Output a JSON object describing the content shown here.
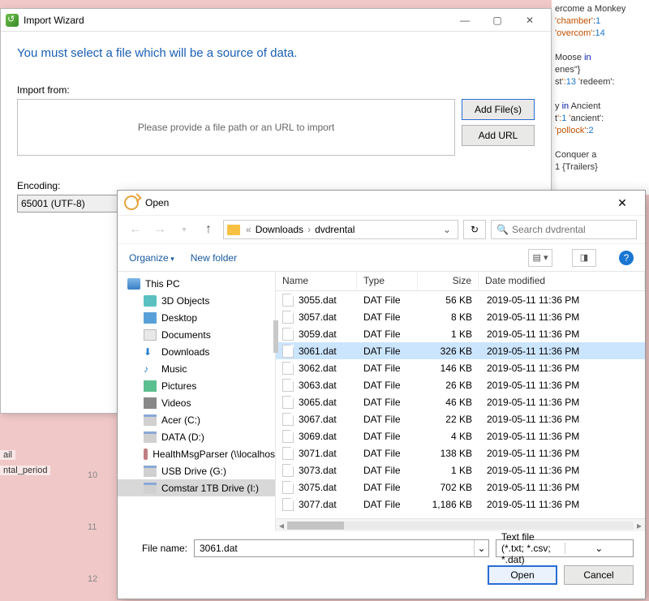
{
  "bg": {
    "lines": [
      "ercome a Monkey",
      "'chamber':1",
      "'overcom':14",
      "",
      "Moose in",
      "enes\"}",
      "st':13 'redeem':",
      "",
      "y in Ancient",
      "t':1 'ancient':",
      "'pollock':2",
      "",
      "Conquer a",
      "1 {Trailers}"
    ],
    "left_frag1": "ail",
    "left_frag2": "ntal_period",
    "ln1": "10",
    "ln2": "11",
    "ln3": "12"
  },
  "wizard": {
    "title": "Import Wizard",
    "headline": "You must select a file which will be a source of data.",
    "import_from": "Import from:",
    "placeholder": "Please provide a file path or an URL to import",
    "add_files": "Add File(s)",
    "add_url": "Add URL",
    "encoding_label": "Encoding:",
    "encoding_value": "65001 (UTF-8)"
  },
  "open": {
    "title": "Open",
    "crumb1": "Downloads",
    "crumb2": "dvdrental",
    "search_placeholder": "Search dvdrental",
    "organize": "Organize",
    "new_folder": "New folder",
    "col_name": "Name",
    "col_type": "Type",
    "col_size": "Size",
    "col_date": "Date modified",
    "tree": {
      "pc": "This PC",
      "o3d": "3D Objects",
      "desk": "Desktop",
      "docs": "Documents",
      "dl": "Downloads",
      "mus": "Music",
      "pic": "Pictures",
      "vid": "Videos",
      "acer": "Acer (C:)",
      "data": "DATA (D:)",
      "health": "HealthMsgParser (\\\\localhos",
      "usb": "USB Drive (G:)",
      "comstar": "Comstar 1TB Drive (I:)"
    },
    "files": [
      {
        "n": "3055.dat",
        "t": "DAT File",
        "s": "56 KB",
        "d": "2019-05-11 11:36 PM"
      },
      {
        "n": "3057.dat",
        "t": "DAT File",
        "s": "8 KB",
        "d": "2019-05-11 11:36 PM"
      },
      {
        "n": "3059.dat",
        "t": "DAT File",
        "s": "1 KB",
        "d": "2019-05-11 11:36 PM"
      },
      {
        "n": "3061.dat",
        "t": "DAT File",
        "s": "326 KB",
        "d": "2019-05-11 11:36 PM"
      },
      {
        "n": "3062.dat",
        "t": "DAT File",
        "s": "146 KB",
        "d": "2019-05-11 11:36 PM"
      },
      {
        "n": "3063.dat",
        "t": "DAT File",
        "s": "26 KB",
        "d": "2019-05-11 11:36 PM"
      },
      {
        "n": "3065.dat",
        "t": "DAT File",
        "s": "46 KB",
        "d": "2019-05-11 11:36 PM"
      },
      {
        "n": "3067.dat",
        "t": "DAT File",
        "s": "22 KB",
        "d": "2019-05-11 11:36 PM"
      },
      {
        "n": "3069.dat",
        "t": "DAT File",
        "s": "4 KB",
        "d": "2019-05-11 11:36 PM"
      },
      {
        "n": "3071.dat",
        "t": "DAT File",
        "s": "138 KB",
        "d": "2019-05-11 11:36 PM"
      },
      {
        "n": "3073.dat",
        "t": "DAT File",
        "s": "1 KB",
        "d": "2019-05-11 11:36 PM"
      },
      {
        "n": "3075.dat",
        "t": "DAT File",
        "s": "702 KB",
        "d": "2019-05-11 11:36 PM"
      },
      {
        "n": "3077.dat",
        "t": "DAT File",
        "s": "1,186 KB",
        "d": "2019-05-11 11:36 PM"
      }
    ],
    "selected_index": 3,
    "filename_label": "File name:",
    "filename_value": "3061.dat",
    "filter": "Text file (*.txt; *.csv; *.dat)",
    "open_btn": "Open",
    "cancel_btn": "Cancel"
  }
}
